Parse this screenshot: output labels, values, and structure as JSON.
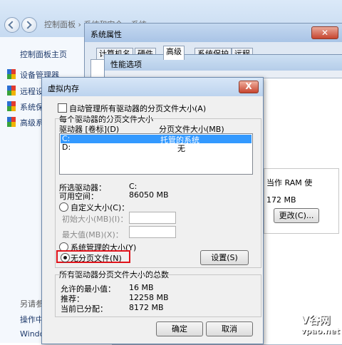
{
  "explorer": {
    "address": "控制面板 › 系统和安全 › 系统",
    "sidebar_home": "控制面板主页",
    "sidebar_items": [
      "设备管理器",
      "远程设",
      "系统保",
      "高级系"
    ],
    "see_also": "另请参",
    "action_center": "操作中",
    "windows": "Windo"
  },
  "sysprop": {
    "title": "系统属性",
    "tabs": [
      "计算机名",
      "硬件",
      "高级",
      "系统保护",
      "远程"
    ],
    "active_tab": "高级",
    "ram_text": "当作 RAM 使",
    "mb_partial": "172 MB",
    "change_button": "更改(C)..."
  },
  "perf": {
    "title": "性能选项"
  },
  "vm": {
    "title": "虚拟内存",
    "close_glyph": "X",
    "auto_manage": "自动管理所有驱动器的分页文件大小(A)",
    "each_drive_group": "每个驱动器的分页文件大小",
    "col_drive": "驱动器 [卷标](D)",
    "col_size": "分页文件大小(MB)",
    "drives": [
      {
        "drive": "C:",
        "size": "托管的系统",
        "selected": true
      },
      {
        "drive": "D:",
        "size": "无",
        "selected": false
      }
    ],
    "selected_drive_label": "所选驱动器：",
    "selected_drive_value": "C:",
    "free_space_label": "可用空间：",
    "free_space_value": "86050 MB",
    "custom_size": "自定义大小(C)：",
    "initial_size": "初始大小(MB)(I)：",
    "max_size": "最大值(MB)(X)：",
    "system_managed": "系统管理的大小(Y)",
    "no_paging": "无分页文件(N)",
    "set_button": "设置(S)",
    "total_group": "所有驱动器分页文件大小的总数",
    "min_allowed_label": "允许的最小值：",
    "min_allowed_value": "16 MB",
    "recommended_label": "推荐：",
    "recommended_value": "12258 MB",
    "current_label": "当前已分配：",
    "current_value": "8172 MB",
    "ok_button": "确定",
    "cancel_button": "取消"
  },
  "watermark": {
    "brand": "V谷网",
    "url": "vpao.net"
  },
  "colors": {
    "selection": "#3399ff",
    "highlight": "#e1131b"
  }
}
